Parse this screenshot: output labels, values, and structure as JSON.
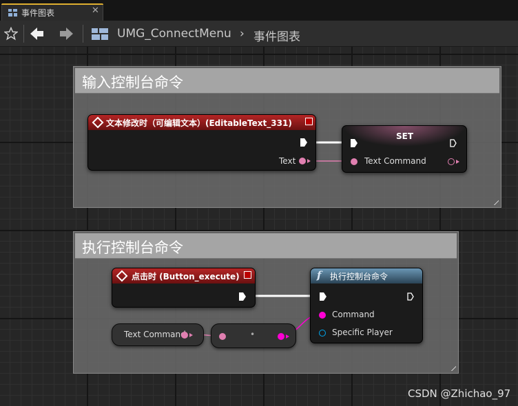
{
  "tab": {
    "label": "事件图表",
    "close": "✕",
    "icon": "blueprint-icon",
    "accent": "#e0b030"
  },
  "toolbar": {
    "crumb_asset": "UMG_ConnectMenu",
    "crumb_sep": "›",
    "crumb_graph": "事件图表"
  },
  "comments": [
    {
      "title": "输入控制台命令"
    },
    {
      "title": "执行控制台命令"
    }
  ],
  "nodes": {
    "text_changed": {
      "title": "文本修改时（可编辑文本）(EditableText_331)",
      "pin_text": "Text"
    },
    "set": {
      "title": "SET",
      "pin_text_command": "Text Command"
    },
    "clicked": {
      "title": "点击时 (Button_execute)"
    },
    "exec_cmd": {
      "title": "执行控制台命令",
      "pin_command": "Command",
      "pin_player": "Specific Player"
    },
    "get_var": {
      "label": "Text Command"
    },
    "conv": {
      "label": "•"
    }
  },
  "colors": {
    "text_pin": "#e07fb0",
    "string_pin": "#ff00d4",
    "object_pin": "#00a8f0",
    "exec_wire": "#ffffff"
  },
  "watermark": "CSDN @Zhichao_97"
}
